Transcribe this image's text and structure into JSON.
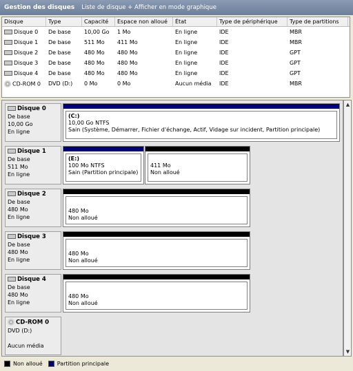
{
  "titlebar": {
    "title": "Gestion des disques",
    "subtitle": "Liste de disque + Afficher en mode graphique"
  },
  "list": {
    "headers": [
      "Disque",
      "Type",
      "Capacité",
      "Espace non alloué",
      "État",
      "Type de périphérique",
      "Type de partitions"
    ],
    "rows": [
      [
        "Disque 0",
        "De base",
        "10,00 Go",
        "1 Mo",
        "En ligne",
        "IDE",
        "MBR"
      ],
      [
        "Disque 1",
        "De base",
        "511 Mo",
        "411 Mo",
        "En ligne",
        "IDE",
        "MBR"
      ],
      [
        "Disque 2",
        "De base",
        "480 Mo",
        "480 Mo",
        "En ligne",
        "IDE",
        "GPT"
      ],
      [
        "Disque 3",
        "De base",
        "480 Mo",
        "480 Mo",
        "En ligne",
        "IDE",
        "GPT"
      ],
      [
        "Disque 4",
        "De base",
        "480 Mo",
        "480 Mo",
        "En ligne",
        "IDE",
        "GPT"
      ],
      [
        "CD-ROM 0",
        "DVD (D:)",
        "0 Mo",
        "0 Mo",
        "Aucun média",
        "IDE",
        "MBR"
      ]
    ]
  },
  "graph": {
    "disks": [
      {
        "name": "Disque 0",
        "type": "De base",
        "size": "10,00 Go",
        "status": "En ligne",
        "partitions": [
          {
            "label": "(C:)",
            "size": "10,00 Go NTFS",
            "status": "Sain (Système, Démarrer, Fichier d'échange, Actif, Vidage sur incident, Partition principale)"
          }
        ]
      },
      {
        "name": "Disque 1",
        "type": "De base",
        "size": "511 Mo",
        "status": "En ligne",
        "partitions": [
          {
            "label": "(E:)",
            "size": "100 Mo NTFS",
            "status": "Sain (Partition principale)"
          },
          {
            "label": "",
            "size": "411 Mo",
            "status": "Non alloué"
          }
        ]
      },
      {
        "name": "Disque 2",
        "type": "De base",
        "size": "480 Mo",
        "status": "En ligne",
        "partitions": [
          {
            "label": "",
            "size": "480 Mo",
            "status": "Non alloué"
          }
        ]
      },
      {
        "name": "Disque 3",
        "type": "De base",
        "size": "480 Mo",
        "status": "En ligne",
        "partitions": [
          {
            "label": "",
            "size": "480 Mo",
            "status": "Non alloué"
          }
        ]
      },
      {
        "name": "Disque 4",
        "type": "De base",
        "size": "480 Mo",
        "status": "En ligne",
        "partitions": [
          {
            "label": "",
            "size": "480 Mo",
            "status": "Non alloué"
          }
        ]
      }
    ],
    "cdrom": {
      "name": "CD-ROM 0",
      "type": "DVD (D:)",
      "status": "Aucun média"
    }
  },
  "legend": {
    "unallocated": "Non alloué",
    "primary": "Partition principale"
  },
  "colors": {
    "unallocated": "#000000",
    "primary": "#00007b",
    "titlebar": "#7d8fa8"
  }
}
